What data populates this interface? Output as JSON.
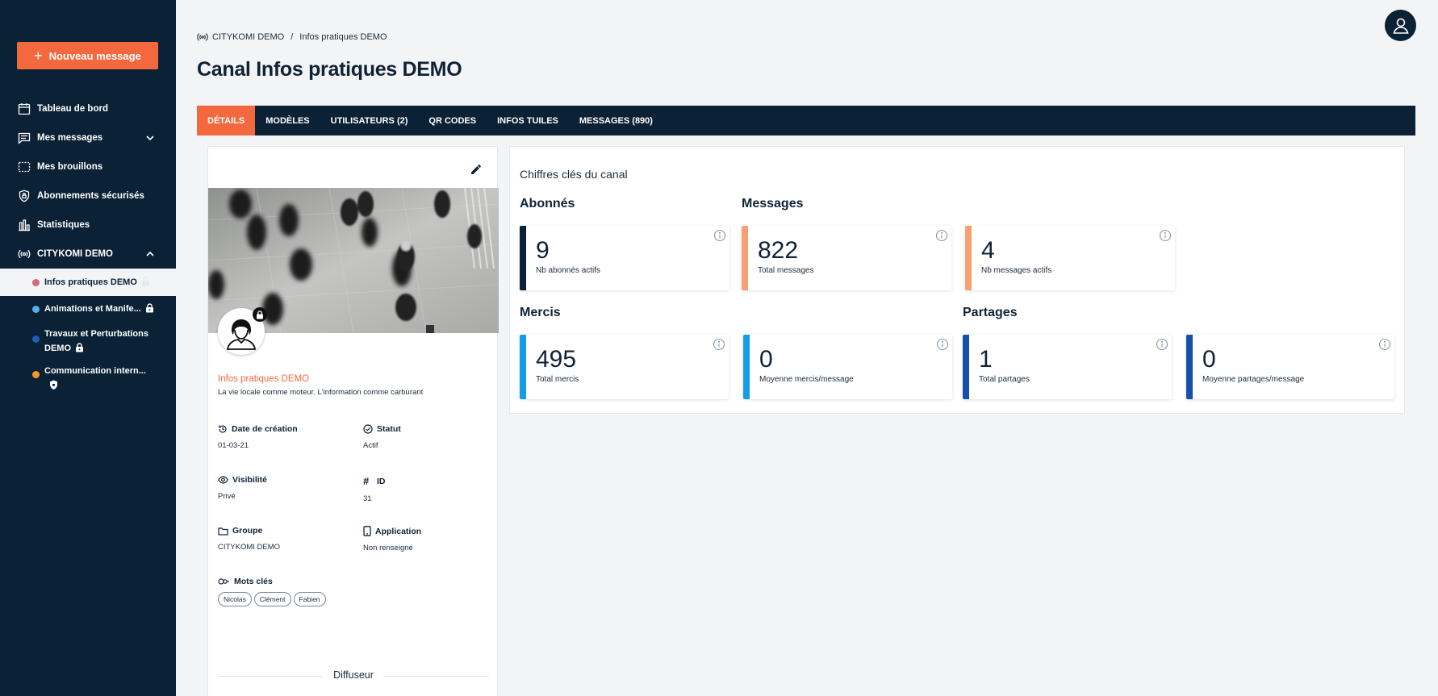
{
  "sidebar": {
    "new_message_label": "Nouveau message",
    "items": [
      {
        "label": "Tableau de bord",
        "icon": "calendar-icon"
      },
      {
        "label": "Mes messages",
        "icon": "message-icon"
      },
      {
        "label": "Mes brouillons",
        "icon": "draft-icon"
      },
      {
        "label": "Abonnements sécurisés",
        "icon": "shield-icon"
      },
      {
        "label": "Statistiques",
        "icon": "stats-icon"
      },
      {
        "label": "CITYKOMI DEMO",
        "icon": "broadcast-icon"
      }
    ],
    "channels": [
      {
        "label": "Infos pratiques DEMO",
        "color": "#d9667a"
      },
      {
        "label": "Animations et Manife...",
        "color": "#4fb3e8"
      },
      {
        "label_line1": "Travaux et Perturbations",
        "label_line2": "DEMO",
        "color": "#1f5fb8"
      },
      {
        "label": "Communication intern...",
        "color": "#f39a2b"
      }
    ]
  },
  "breadcrumb": {
    "root": "CITYKOMI DEMO",
    "separator": "/",
    "current": "Infos pratiques DEMO"
  },
  "page_title": "Canal Infos pratiques DEMO",
  "tabs": [
    "DÉTAILS",
    "MODÈLES",
    "UTILISATEURS (2)",
    "QR CODES",
    "INFOS TUILES",
    "MESSAGES (890)"
  ],
  "channel": {
    "name": "Infos pratiques DEMO",
    "description": "La vie locale comme moteur. L'information comme carburant",
    "fields": {
      "creation": {
        "label": "Date de création",
        "value": "01-03-21"
      },
      "status": {
        "label": "Statut",
        "value": "Actif"
      },
      "visibility": {
        "label": "Visibilité",
        "value": "Privé"
      },
      "id": {
        "label": "ID",
        "value": "31"
      },
      "group": {
        "label": "Groupe",
        "value": "CITYKOMI DEMO"
      },
      "application": {
        "label": "Application",
        "value": "Non renseigné"
      },
      "keywords": {
        "label": "Mots clés"
      }
    },
    "tags": [
      "Nicolas",
      "Clément",
      "Fabien"
    ],
    "diffuseur_label": "Diffuseur"
  },
  "key_figures": {
    "title": "Chiffres clés du canal",
    "sections": {
      "abonnes": "Abonnés",
      "messages": "Messages",
      "mercis": "Mercis",
      "partages": "Partages"
    },
    "stats": [
      {
        "value": "9",
        "label": "Nb abonnés actifs",
        "color": "#0b2136"
      },
      {
        "value": "822",
        "label": "Total messages",
        "color": "#f7a072"
      },
      {
        "value": "4",
        "label": "Nb messages actifs",
        "color": "#f7a072"
      },
      {
        "value": "495",
        "label": "Total mercis",
        "color": "#149ce6"
      },
      {
        "value": "0",
        "label": "Moyenne mercis/message",
        "color": "#149ce6"
      },
      {
        "value": "1",
        "label": "Total partages",
        "color": "#1650a8"
      },
      {
        "value": "0",
        "label": "Moyenne partages/message",
        "color": "#1650a8"
      }
    ]
  },
  "colors": {
    "navy": "#0b2136",
    "accent": "#f4683e"
  }
}
